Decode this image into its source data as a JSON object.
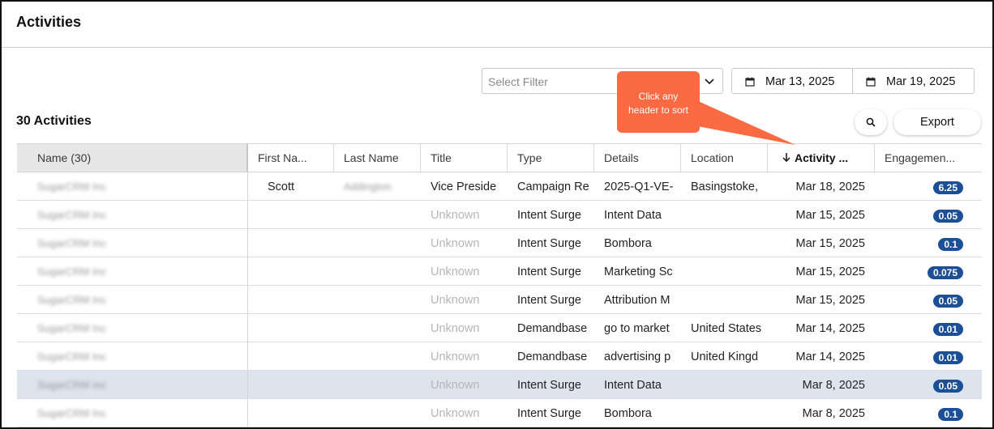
{
  "page": {
    "title": "Activities"
  },
  "filter": {
    "placeholder": "Select Filter",
    "icon": "chevron-down-icon"
  },
  "date_range": {
    "start": "Mar 13, 2025",
    "end": "Mar 19, 2025",
    "icon": "calendar-icon"
  },
  "tooltip": {
    "line1": "Click any",
    "line2": "header to sort",
    "color": "#fb6a42"
  },
  "summary": {
    "count_label": "30 Activities"
  },
  "toolbar": {
    "search_icon": "search-icon",
    "export_label": "Export"
  },
  "table": {
    "columns": [
      {
        "key": "name",
        "label": "Name (30)"
      },
      {
        "key": "first_name",
        "label": "First Na..."
      },
      {
        "key": "last_name",
        "label": "Last Name"
      },
      {
        "key": "title",
        "label": "Title"
      },
      {
        "key": "type",
        "label": "Type"
      },
      {
        "key": "details",
        "label": "Details"
      },
      {
        "key": "location",
        "label": "Location"
      },
      {
        "key": "activity_date",
        "label": "Activity ...",
        "sorted": "descending"
      },
      {
        "key": "engagement",
        "label": "Engagemen..."
      }
    ],
    "rows": [
      {
        "name": "SugarCRM Inc",
        "first_name": "Scott",
        "last_name": "Addington",
        "title": "Vice Preside",
        "type": "Campaign Re",
        "details": "2025-Q1-VE-",
        "location": "Basingstoke,",
        "activity_date": "Mar 18, 2025",
        "engagement": "6.25"
      },
      {
        "name": "SugarCRM Inc",
        "first_name": "",
        "last_name": "",
        "title": "Unknown",
        "type": "Intent Surge",
        "details": "Intent Data",
        "location": "",
        "activity_date": "Mar 15, 2025",
        "engagement": "0.05"
      },
      {
        "name": "SugarCRM Inc",
        "first_name": "",
        "last_name": "",
        "title": "Unknown",
        "type": "Intent Surge",
        "details": "Bombora",
        "location": "",
        "activity_date": "Mar 15, 2025",
        "engagement": "0.1"
      },
      {
        "name": "SugarCRM Inc",
        "first_name": "",
        "last_name": "",
        "title": "Unknown",
        "type": "Intent Surge",
        "details": "Marketing Sc",
        "location": "",
        "activity_date": "Mar 15, 2025",
        "engagement": "0.075"
      },
      {
        "name": "SugarCRM Inc",
        "first_name": "",
        "last_name": "",
        "title": "Unknown",
        "type": "Intent Surge",
        "details": "Attribution M",
        "location": "",
        "activity_date": "Mar 15, 2025",
        "engagement": "0.05"
      },
      {
        "name": "SugarCRM Inc",
        "first_name": "",
        "last_name": "",
        "title": "Unknown",
        "type": "Demandbase",
        "details": "go to market",
        "location": "United States",
        "activity_date": "Mar 14, 2025",
        "engagement": "0.01"
      },
      {
        "name": "SugarCRM Inc",
        "first_name": "",
        "last_name": "",
        "title": "Unknown",
        "type": "Demandbase",
        "details": "advertising p",
        "location": "United Kingd",
        "activity_date": "Mar 14, 2025",
        "engagement": "0.01"
      },
      {
        "name": "SugarCRM Inc",
        "first_name": "",
        "last_name": "",
        "title": "Unknown",
        "type": "Intent Surge",
        "details": "Intent Data",
        "location": "",
        "activity_date": "Mar 8, 2025",
        "engagement": "0.05",
        "highlighted": true
      },
      {
        "name": "SugarCRM Inc",
        "first_name": "",
        "last_name": "",
        "title": "Unknown",
        "type": "Intent Surge",
        "details": "Bombora",
        "location": "",
        "activity_date": "Mar 8, 2025",
        "engagement": "0.1"
      }
    ]
  },
  "colors": {
    "badge": "#1c4f96",
    "row_highlight": "#dde4ee",
    "muted_text": "#b6b6b6"
  }
}
